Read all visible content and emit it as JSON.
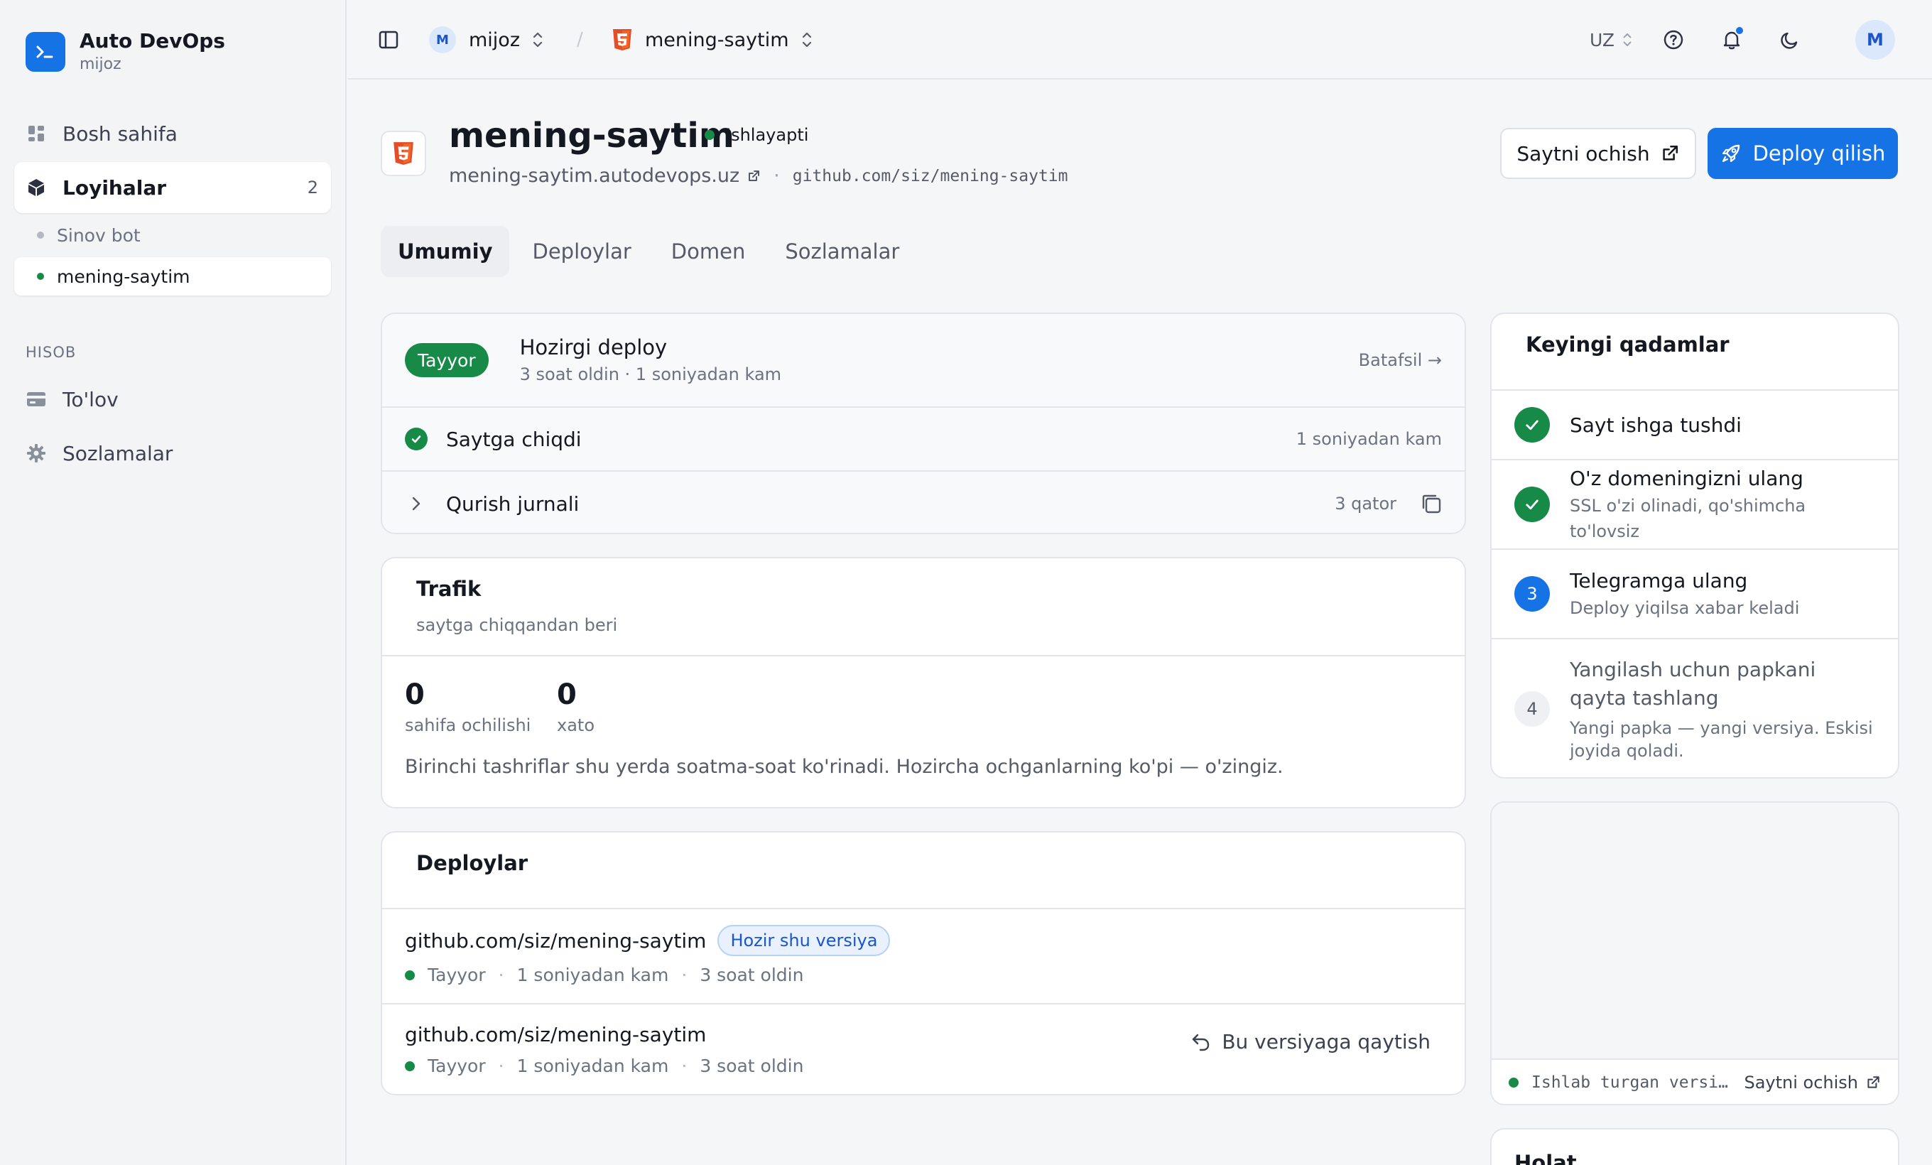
{
  "brand": {
    "title": "Auto DevOps",
    "subtitle": "mijoz"
  },
  "sidebar": {
    "items": [
      {
        "label": "Bosh sahifa",
        "icon": "dashboard-icon"
      },
      {
        "label": "Loyihalar",
        "icon": "cube-icon",
        "count": "2"
      }
    ],
    "projects": [
      {
        "label": "Sinov bot",
        "status_color": "#9aa0aa"
      },
      {
        "label": "mening-saytim",
        "status_color": "#178a48"
      }
    ],
    "section_label": "HISOB",
    "account_items": [
      {
        "label": "To'lov",
        "icon": "credit-card-icon"
      },
      {
        "label": "Sozlamalar",
        "icon": "gear-icon"
      }
    ]
  },
  "topbar": {
    "org_initial": "M",
    "org_name": "mijoz",
    "separator": "/",
    "project_name": "mening-saytim",
    "language": "UZ",
    "user_initial": "M"
  },
  "header": {
    "title": "mening-saytim",
    "status": "Ishlayapti",
    "domain": "mening-saytim.autodevops.uz",
    "meta_separator": "·",
    "repo": "github.com/siz/mening-saytim",
    "open_site_label": "Saytni ochish",
    "deploy_label": "Deploy qilish"
  },
  "tabs": [
    "Umumiy",
    "Deploylar",
    "Domen",
    "Sozlamalar"
  ],
  "current_deploy": {
    "badge": "Tayyor",
    "title": "Hozirgi deploy",
    "meta": "3 soat oldin · 1 soniyadan kam",
    "details_link": "Batafsil →",
    "step_label": "Saytga chiqdi",
    "step_time": "1 soniyadan kam",
    "log_label": "Qurish jurnali",
    "log_lines": "3 qator"
  },
  "traffic": {
    "title": "Trafik",
    "subtitle": "saytga chiqqandan beri",
    "stats": [
      {
        "value": "0",
        "label": "sahifa ochilishi"
      },
      {
        "value": "0",
        "label": "xato"
      }
    ],
    "note": "Birinchi tashriflar shu yerda soatma-soat ko'rinadi. Hozircha ochganlarning ko'pi — o'zingiz."
  },
  "deploys": {
    "title": "Deploylar",
    "current_chip": "Hozir shu versiya",
    "rollback_label": "Bu versiyaga qaytish",
    "items": [
      {
        "repo": "github.com/siz/mening-saytim",
        "status": "Tayyor",
        "duration": "1 soniyadan kam",
        "age": "3 soat oldin",
        "sep": "·"
      },
      {
        "repo": "github.com/siz/mening-saytim",
        "status": "Tayyor",
        "duration": "1 soniyadan kam",
        "age": "3 soat oldin",
        "sep": "·"
      }
    ]
  },
  "next_steps": {
    "title": "Keyingi qadamlar",
    "steps": [
      {
        "title": "Sayt ishga tushdi",
        "desc": "",
        "state": "done"
      },
      {
        "title": "O'z domeningizni ulang",
        "desc": "SSL o'zi olinadi, qo'shimcha to'lovsiz",
        "state": "done"
      },
      {
        "title": "Telegramga ulang",
        "desc": "Deploy yiqilsa xabar keladi",
        "state": "current",
        "num": "3"
      },
      {
        "title": "Yangilash uchun papkani qayta tashlang",
        "desc": "Yangi papka — yangi versiya. Eskisi joyida qoladi.",
        "state": "todo",
        "num": "4"
      }
    ]
  },
  "preview": {
    "running_label": "Ishlab turgan versi…",
    "open_label": "Saytni ochish"
  },
  "status_card": {
    "title": "Holat"
  },
  "colors": {
    "accent": "#1673e6",
    "success": "#178a48",
    "html5": "#e44d26"
  }
}
